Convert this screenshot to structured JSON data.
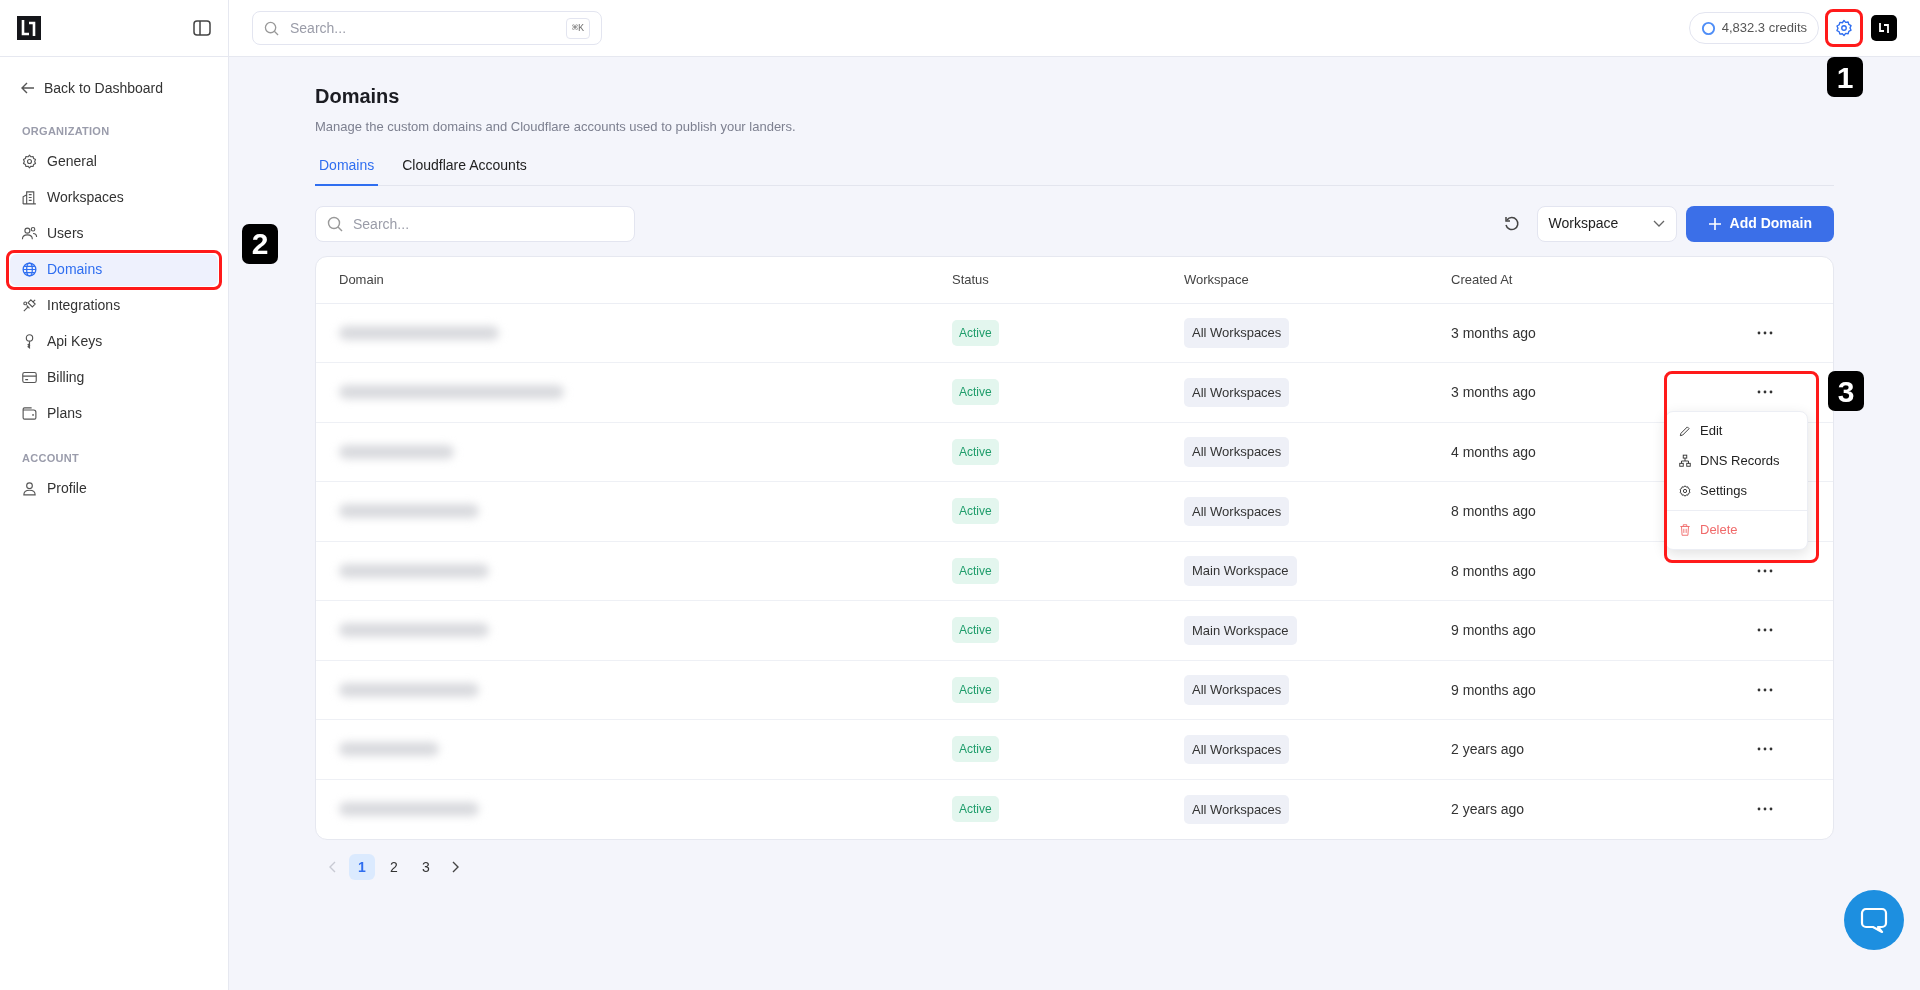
{
  "topbar": {
    "search": {
      "placeholder": "Search...",
      "shortcut": "⌘K"
    },
    "credits": "4,832.3 credits"
  },
  "sidebar": {
    "back": "Back to Dashboard",
    "sections": [
      {
        "title": "ORGANIZATION",
        "items": [
          {
            "label": "General",
            "selected": false
          },
          {
            "label": "Workspaces",
            "selected": false
          },
          {
            "label": "Users",
            "selected": false
          },
          {
            "label": "Domains",
            "selected": true
          },
          {
            "label": "Integrations",
            "selected": false
          },
          {
            "label": "Api Keys",
            "selected": false
          },
          {
            "label": "Billing",
            "selected": false
          },
          {
            "label": "Plans",
            "selected": false
          }
        ]
      },
      {
        "title": "ACCOUNT",
        "items": [
          {
            "label": "Profile",
            "selected": false
          }
        ]
      }
    ]
  },
  "page": {
    "title": "Domains",
    "subtitle": "Manage the custom domains and Cloudflare accounts used to publish your landers.",
    "tabs": [
      {
        "label": "Domains",
        "selected": true
      },
      {
        "label": "Cloudflare Accounts",
        "selected": false
      }
    ],
    "search": {
      "placeholder": "Search..."
    },
    "filter": "Workspace",
    "add_button": "Add Domain"
  },
  "table": {
    "columns": [
      "Domain",
      "Status",
      "Workspace",
      "Created At"
    ],
    "rows": [
      {
        "status": "Active",
        "workspace": "All Workspaces",
        "created": "3 months ago",
        "show_actions": true,
        "menu_open": false
      },
      {
        "status": "Active",
        "workspace": "All Workspaces",
        "created": "3 months ago",
        "show_actions": true,
        "menu_open": true
      },
      {
        "status": "Active",
        "workspace": "All Workspaces",
        "created": "4 months ago",
        "show_actions": false,
        "menu_open": false
      },
      {
        "status": "Active",
        "workspace": "All Workspaces",
        "created": "8 months ago",
        "show_actions": false,
        "menu_open": false
      },
      {
        "status": "Active",
        "workspace": "Main Workspace",
        "created": "8 months ago",
        "show_actions": true,
        "menu_open": false
      },
      {
        "status": "Active",
        "workspace": "Main Workspace",
        "created": "9 months ago",
        "show_actions": true,
        "menu_open": false
      },
      {
        "status": "Active",
        "workspace": "All Workspaces",
        "created": "9 months ago",
        "show_actions": true,
        "menu_open": false
      },
      {
        "status": "Active",
        "workspace": "All Workspaces",
        "created": "2 years ago",
        "show_actions": true,
        "menu_open": false
      },
      {
        "status": "Active",
        "workspace": "All Workspaces",
        "created": "2 years ago",
        "show_actions": true,
        "menu_open": false
      }
    ]
  },
  "row_menu": {
    "items": [
      {
        "label": "Edit",
        "kind": "edit"
      },
      {
        "label": "DNS Records",
        "kind": "dns"
      },
      {
        "label": "Settings",
        "kind": "settings"
      },
      {
        "label": "Delete",
        "kind": "delete"
      }
    ]
  },
  "pagination": {
    "pages": [
      {
        "label": "1",
        "selected": true
      },
      {
        "label": "2",
        "selected": false
      },
      {
        "label": "3",
        "selected": false
      }
    ]
  },
  "callouts": [
    {
      "number": "1"
    },
    {
      "number": "2"
    },
    {
      "number": "3"
    }
  ]
}
